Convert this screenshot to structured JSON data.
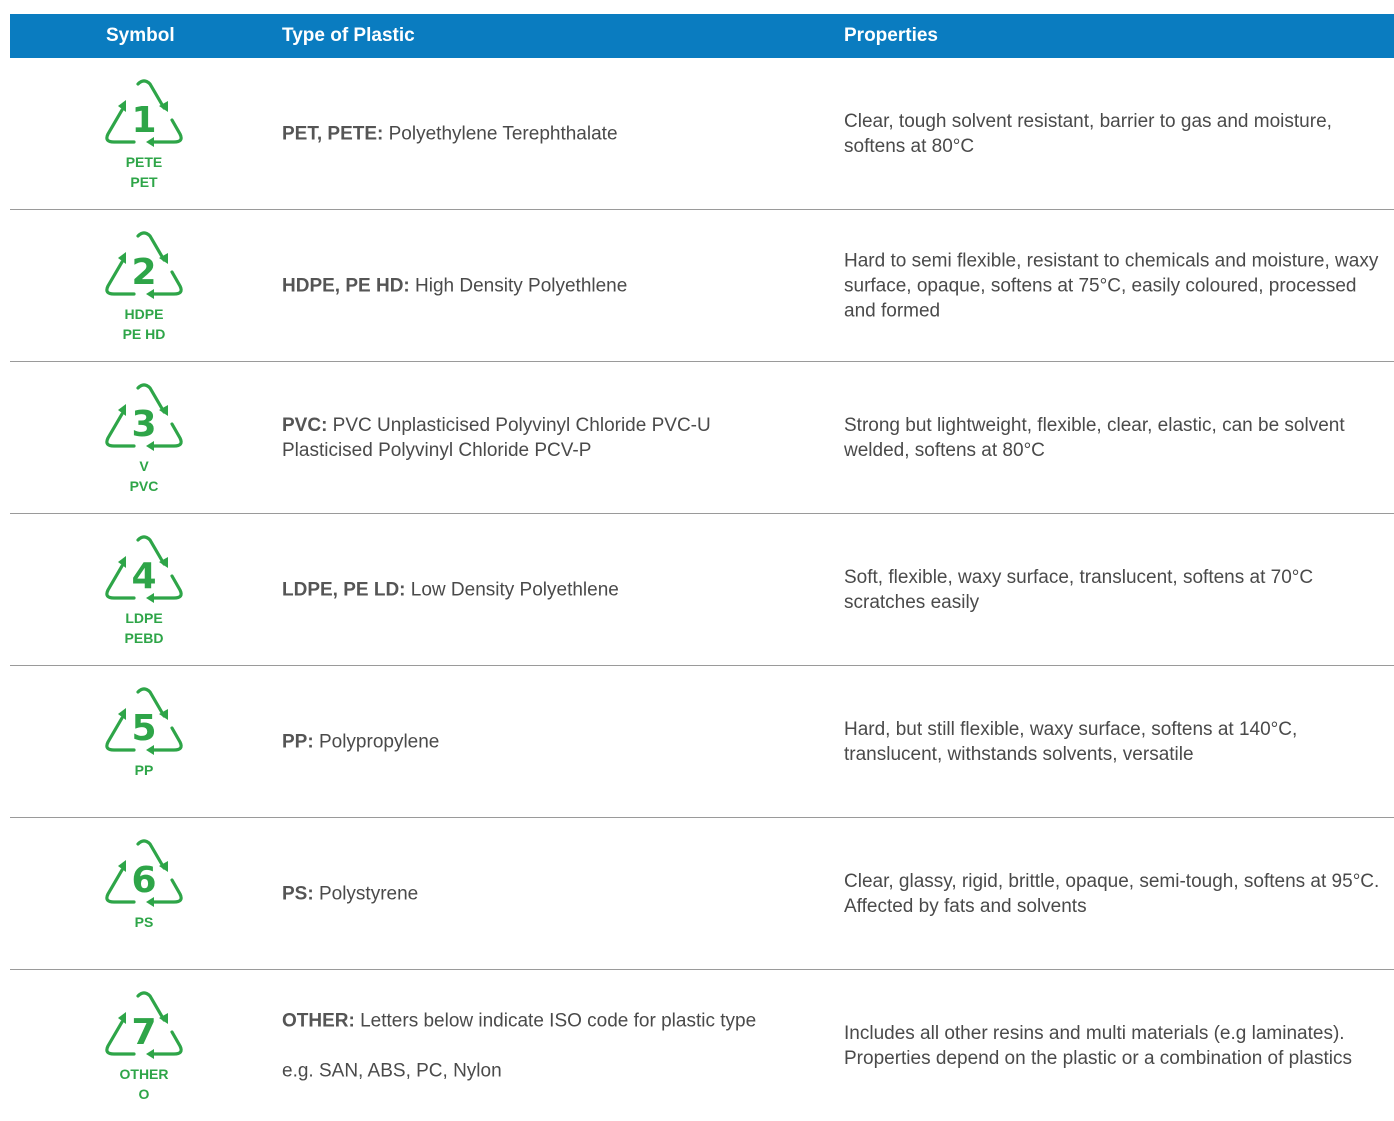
{
  "header": {
    "symbol": "Symbol",
    "type": "Type of Plastic",
    "properties": "Properties"
  },
  "colors": {
    "header_bg": "#0a7cc0",
    "symbol_green": "#2ea548"
  },
  "rows": [
    {
      "number": "1",
      "codes": [
        "PETE",
        "PET"
      ],
      "type_bold": "PET, PETE:",
      "type_text": " Polyethylene Terephthalate",
      "properties": "Clear, tough solvent resistant, barrier to gas and moisture, softens at 80°C"
    },
    {
      "number": "2",
      "codes": [
        "HDPE",
        "PE HD"
      ],
      "type_bold": "HDPE, PE HD:",
      "type_text": " High Density Polyethlene",
      "properties": "Hard to semi flexible, resistant to chemicals and moisture, waxy surface, opaque, softens at 75°C, easily coloured, processed and formed"
    },
    {
      "number": "3",
      "codes": [
        "V",
        "PVC"
      ],
      "type_bold": "PVC:",
      "type_text": " PVC Unplasticised Polyvinyl Chloride PVC-U Plasticised Polyvinyl Chloride PCV-P",
      "properties": "Strong but lightweight, flexible, clear, elastic, can be solvent welded, softens at 80°C"
    },
    {
      "number": "4",
      "codes": [
        "LDPE",
        "PEBD"
      ],
      "type_bold": "LDPE, PE LD:",
      "type_text": " Low Density Polyethlene",
      "properties": "Soft, flexible, waxy surface, translucent, softens at 70°C scratches easily"
    },
    {
      "number": "5",
      "codes": [
        "PP",
        ""
      ],
      "type_bold": "PP:",
      "type_text": " Polypropylene",
      "properties": "Hard, but still flexible, waxy surface, softens at 140°C, translucent, withstands solvents, versatile"
    },
    {
      "number": "6",
      "codes": [
        "PS",
        ""
      ],
      "type_bold": "PS:",
      "type_text": " Polystyrene",
      "properties": "Clear, glassy, rigid, brittle, opaque, semi-tough, softens at 95°C. Affected by fats and solvents"
    },
    {
      "number": "7",
      "codes": [
        "OTHER",
        "O"
      ],
      "type_bold": "OTHER:",
      "type_text": " Letters below indicate ISO code for plastic type",
      "type_extra": "e.g. SAN, ABS, PC, Nylon",
      "properties": "Includes all other resins and multi materials (e.g laminates). Properties depend on the plastic or a combination of plastics"
    }
  ]
}
